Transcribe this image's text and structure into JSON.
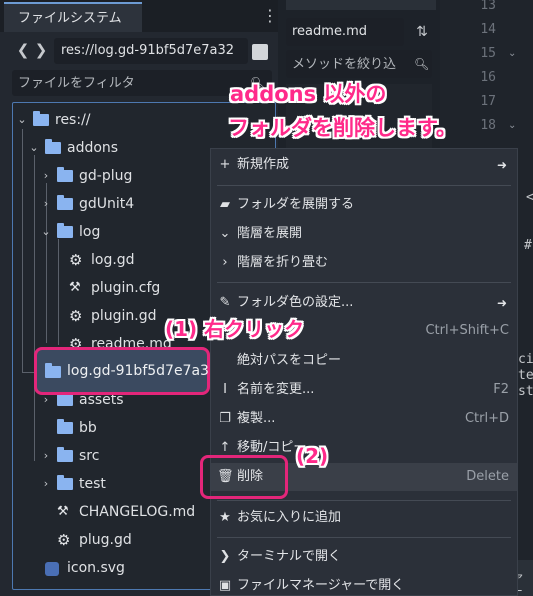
{
  "dock": {
    "tab_label": "ファイルシステム",
    "menu_icon": "kebab-menu-icon",
    "nav": {
      "back_icon": "chevron-left-icon",
      "forward_icon": "chevron-right-icon",
      "path": "res://log.gd-91bf5d7e7a32"
    },
    "filter_placeholder": "ファイルをフィルタ",
    "tree": [
      {
        "label": "res://",
        "icon": "folder-icon",
        "arrow": "v"
      },
      {
        "label": "addons",
        "icon": "folder-icon",
        "arrow": "v"
      },
      {
        "label": "gd-plug",
        "icon": "folder-icon",
        "arrow": ">"
      },
      {
        "label": "gdUnit4",
        "icon": "folder-icon",
        "arrow": ">"
      },
      {
        "label": "log",
        "icon": "folder-icon",
        "arrow": "v"
      },
      {
        "label": "log.gd",
        "icon": "gear-icon"
      },
      {
        "label": "plugin.cfg",
        "icon": "config-icon"
      },
      {
        "label": "plugin.gd",
        "icon": "gear-icon"
      },
      {
        "label": "readme.md",
        "icon": "gear-icon"
      },
      {
        "label": "log.gd-91bf5d7e7a32",
        "icon": "folder-icon"
      },
      {
        "label": "assets",
        "icon": "folder-icon",
        "arrow": ">"
      },
      {
        "label": "bb",
        "icon": "folder-icon"
      },
      {
        "label": "src",
        "icon": "folder-icon",
        "arrow": ">"
      },
      {
        "label": "test",
        "icon": "folder-icon",
        "arrow": ">"
      },
      {
        "label": "CHANGELOG.md",
        "icon": "config-icon"
      },
      {
        "label": "plug.gd",
        "icon": "gear-icon"
      },
      {
        "label": "icon.svg",
        "icon": "godot-icon"
      }
    ]
  },
  "middle": {
    "script_name": "readme.md",
    "sort_icon": "sort-icon",
    "method_filter_placeholder": "メソッドを絞り込",
    "search_icon": "search-icon"
  },
  "editor": {
    "line_numbers": [
      "13",
      "14",
      "15",
      "16",
      "17",
      "18"
    ],
    "frag_1": "<",
    "frag_2": "#",
    "frag_3": "ci",
    "frag_4": "te",
    "frag_5": "st",
    "bottom_text": "ァニ"
  },
  "context_menu": {
    "items": [
      {
        "icon": "plus-icon",
        "label": "新規作成",
        "submenu": "➜"
      },
      {
        "icon": "folder-open-icon",
        "label": "フォルダを展開する"
      },
      {
        "icon": "chevron-down-icon",
        "label": "階層を展開"
      },
      {
        "icon": "chevron-right-icon",
        "label": "階層を折り畳む"
      },
      {
        "icon": "brush-icon",
        "label": "フォルダ色の設定...",
        "submenu": "➜"
      },
      {
        "shortcut": "Ctrl+Shift+C"
      },
      {
        "label": "絶対パスをコピー"
      },
      {
        "icon": "rename-icon",
        "label": "名前を変更...",
        "shortcut": "F2"
      },
      {
        "icon": "duplicate-icon",
        "label": "複製...",
        "shortcut": "Ctrl+D"
      },
      {
        "icon": "move-icon",
        "label": "移動/コピー..."
      },
      {
        "icon": "trash-icon",
        "label": "削除",
        "shortcut": "Delete"
      },
      {
        "icon": "star-icon",
        "label": "お気に入りに追加"
      },
      {
        "icon": "terminal-icon",
        "label": "ターミナルで開く"
      },
      {
        "icon": "file-manager-icon",
        "label": "ファイルマネージャーで開く"
      }
    ]
  },
  "annotations": {
    "headline_line1": "addons 以外の",
    "headline_line2": "フォルダを削除します。",
    "step1": "(1) 右クリック",
    "step2": "(2)",
    "accent_color": "#ff2a8a",
    "outline_color": "#e3267a"
  }
}
